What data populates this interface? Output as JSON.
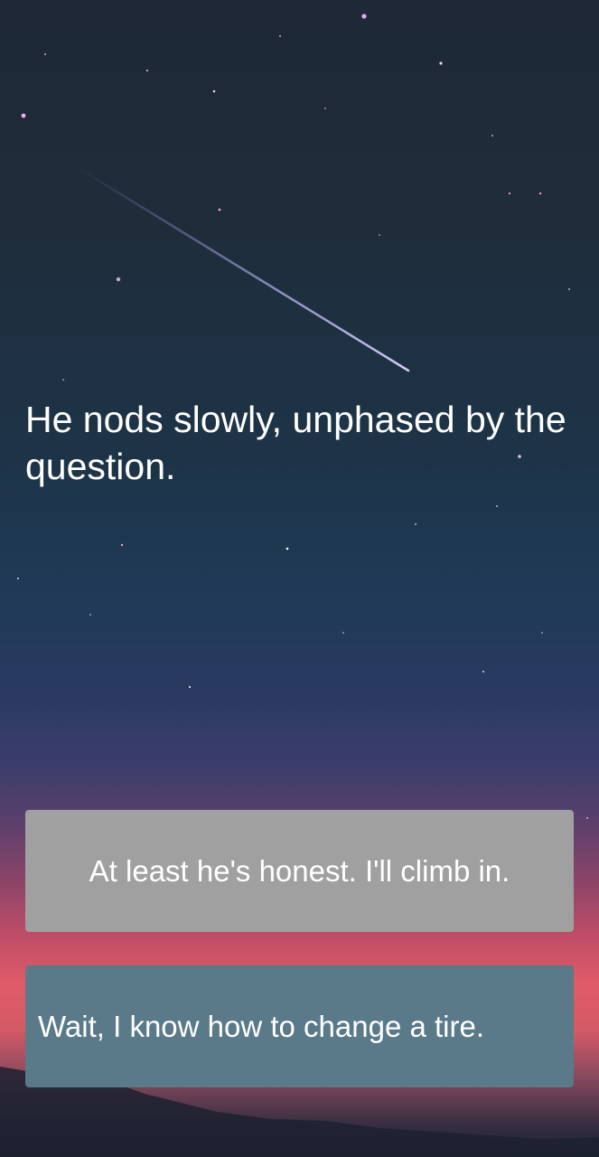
{
  "story": {
    "narration": "He nods slowly, unphased by the question."
  },
  "choices": [
    {
      "label": "At least he's honest. I'll climb in.",
      "color": "#a0a0a0"
    },
    {
      "label": "Wait, I know how to change a tire.",
      "color": "#5a7a8a"
    }
  ]
}
